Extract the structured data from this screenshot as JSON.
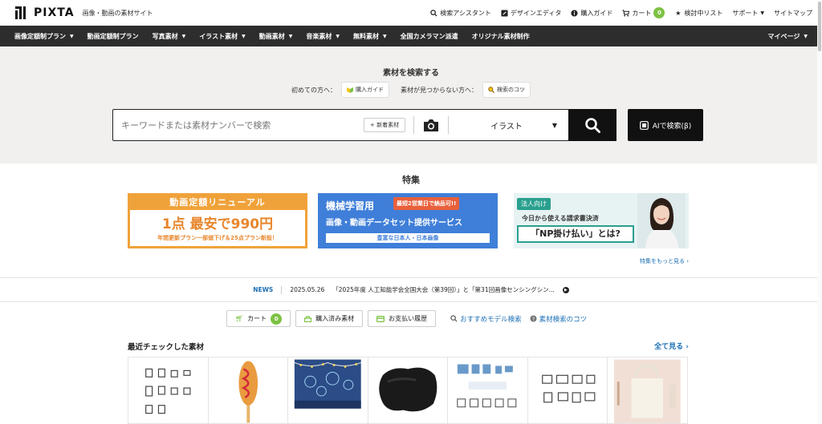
{
  "header": {
    "logo_text": "PIXTA",
    "tagline": "画像・動画の素材サイト",
    "links": {
      "search_assistant": "検索アシスタント",
      "design_editor": "デザインエディタ",
      "purchase_guide": "購入ガイド",
      "cart": "カート",
      "cart_count": "0",
      "wishlist": "検討中リスト",
      "support": "サポート",
      "sitemap": "サイトマップ"
    }
  },
  "nav": {
    "items": [
      "画像定額制プラン",
      "動画定額制プラン",
      "写真素材",
      "イラスト素材",
      "動画素材",
      "音楽素材",
      "無料素材",
      "全国カメラマン派遣",
      "オリジナル素材制作"
    ],
    "mypage": "マイページ"
  },
  "search": {
    "heading": "素材を検索する",
    "first_time_label": "初めての方へ：",
    "first_time_btn": "購入ガイド",
    "not_found_label": "素材が見つからない方へ：",
    "not_found_btn": "検索のコツ",
    "placeholder": "キーワードまたは素材ナンバーで検索",
    "new_btn": "+ 新着素材",
    "type_value": "イラスト",
    "ai_btn": "AIで検索(β)"
  },
  "feature": {
    "title": "特集",
    "banner1": {
      "top": "動画定額リニューアル",
      "mid": "1点 最安で990円",
      "bot": "年間更新プラン一部値下げ＆25点プラン新設！"
    },
    "banner2": {
      "title": "機械学習用",
      "tag": "最短2営業日で納品可!!",
      "sub": "画像・動画データセット提供サービス",
      "strip": "豊富な日本人・日本画像"
    },
    "banner3": {
      "tag": "法人向け",
      "line1": "今日から使える請求書決済",
      "line2": "「NP掛け払い」とは?"
    },
    "more": "特集をもっと見る"
  },
  "news": {
    "label": "NEWS",
    "date": "2025.05.26",
    "text": "「2025年度 人工知能学会全国大会（第39回）」と「第31回画像センシングシン..."
  },
  "quick": {
    "cart": "カート",
    "cart_count": "0",
    "purchased": "購入済み素材",
    "payment": "お支払い履歴",
    "model_search": "おすすめモデル検索",
    "search_tips": "素材検索のコツ"
  },
  "recent": {
    "title": "最近チェックした素材",
    "see_all": "全て見る"
  },
  "colors": {
    "nav_bg": "#2d2d2d",
    "accent_green": "#7cc242",
    "link_blue": "#1a6fb5",
    "banner_orange": "#f0a23a",
    "banner_blue": "#3f7fd9",
    "banner_teal": "#2aa08f"
  }
}
